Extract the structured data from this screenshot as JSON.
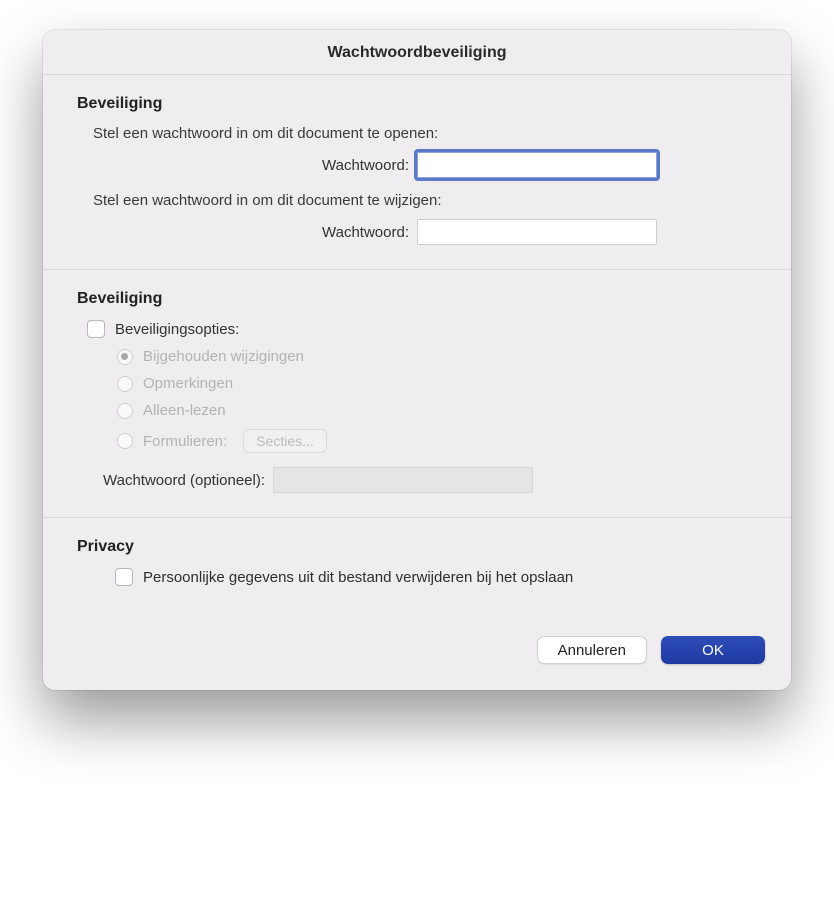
{
  "title": "Wachtwoordbeveiliging",
  "section1": {
    "heading": "Beveiliging",
    "open_desc": "Stel een wachtwoord in om dit document te openen:",
    "open_label": "Wachtwoord:",
    "open_value": "",
    "modify_desc": "Stel een wachtwoord in om dit document te wijzigen:",
    "modify_label": "Wachtwoord:",
    "modify_value": ""
  },
  "section2": {
    "heading": "Beveiliging",
    "options_label": "Beveiligingsopties:",
    "radios": {
      "tracked": "Bijgehouden wijzigingen",
      "comments": "Opmerkingen",
      "readonly": "Alleen-lezen",
      "forms": "Formulieren:"
    },
    "sections_btn": "Secties...",
    "optional_pw_label": "Wachtwoord (optioneel):",
    "optional_pw_value": ""
  },
  "section3": {
    "heading": "Privacy",
    "remove_personal": "Persoonlijke gegevens uit dit bestand verwijderen bij het opslaan"
  },
  "buttons": {
    "cancel": "Annuleren",
    "ok": "OK"
  }
}
